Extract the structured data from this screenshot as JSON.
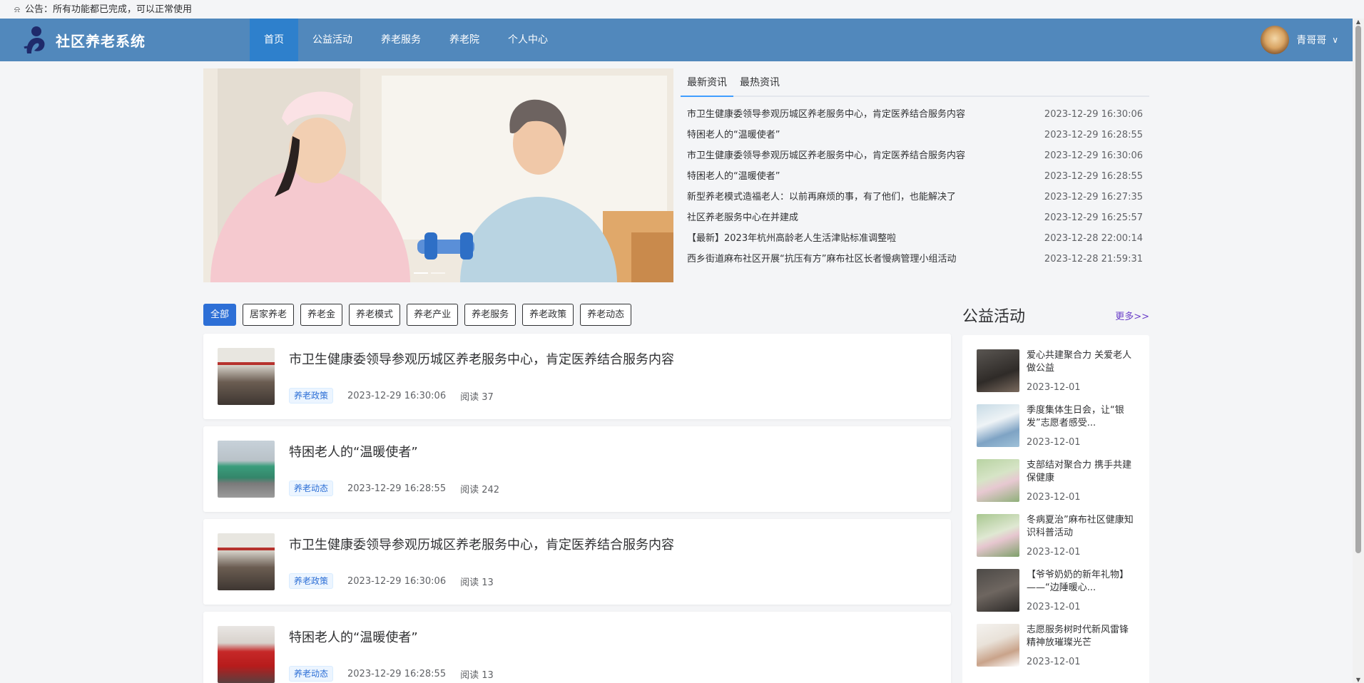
{
  "notice": {
    "text": "公告：所有功能都已完成，可以正常使用"
  },
  "brand": {
    "title": "社区养老系统",
    "nav_color": "#5188bc",
    "active_color": "#2e80cc"
  },
  "nav": {
    "items": [
      {
        "label": "首页",
        "active": true
      },
      {
        "label": "公益活动"
      },
      {
        "label": "养老服务"
      },
      {
        "label": "养老院"
      },
      {
        "label": "个人中心"
      }
    ]
  },
  "user": {
    "name": "青哥哥"
  },
  "news": {
    "tabs": [
      "最新资讯",
      "最热资讯"
    ],
    "items": [
      {
        "title": "市卫生健康委领导参观历城区养老服务中心，肯定医养结合服务内容",
        "date": "2023-12-29 16:30:06"
      },
      {
        "title": "特困老人的“温暖使者”",
        "date": "2023-12-29 16:28:55"
      },
      {
        "title": "市卫生健康委领导参观历城区养老服务中心，肯定医养结合服务内容",
        "date": "2023-12-29 16:30:06"
      },
      {
        "title": "特困老人的“温暖使者”",
        "date": "2023-12-29 16:28:55"
      },
      {
        "title": "新型养老模式造福老人：以前再麻烦的事，有了他们，也能解决了",
        "date": "2023-12-29 16:27:35"
      },
      {
        "title": "社区养老服务中心在并建成",
        "date": "2023-12-29 16:25:57"
      },
      {
        "title": "【最新】2023年杭州高龄老人生活津贴标准调整啦",
        "date": "2023-12-28 22:00:14"
      },
      {
        "title": "西乡街道麻布社区开展“抗压有方”麻布社区长者慢病管理小组活动",
        "date": "2023-12-28 21:59:31"
      }
    ]
  },
  "filters": [
    "全部",
    "居家养老",
    "养老金",
    "养老模式",
    "养老产业",
    "养老服务",
    "养老政策",
    "养老动态"
  ],
  "articles": [
    {
      "title": "市卫生健康委领导参观历城区养老服务中心，肯定医养结合服务内容",
      "tag": "养老政策",
      "time": "2023-12-29 16:30:06",
      "reads": "阅读 37",
      "thumb": "classroom"
    },
    {
      "title": "特困老人的“温暖使者”",
      "tag": "养老动态",
      "time": "2023-12-29 16:28:55",
      "reads": "阅读 242",
      "thumb": "street"
    },
    {
      "title": "市卫生健康委领导参观历城区养老服务中心，肯定医养结合服务内容",
      "tag": "养老政策",
      "time": "2023-12-29 16:30:06",
      "reads": "阅读 13",
      "thumb": "classroom"
    },
    {
      "title": "特困老人的“温暖使者”",
      "tag": "养老动态",
      "time": "2023-12-29 16:28:55",
      "reads": "阅读 13",
      "thumb": "red"
    }
  ],
  "activities": {
    "heading": "公益活动",
    "more": "更多>>",
    "items": [
      {
        "title": "爱心共建聚合力 关爱老人做公益",
        "date": "2023-12-01"
      },
      {
        "title": "季度集体生日会，让“银发”志愿者感受...",
        "date": "2023-12-01"
      },
      {
        "title": "支部结对聚合力 携手共建保健康",
        "date": "2023-12-01"
      },
      {
        "title": "冬病夏治”麻布社区健康知识科普活动",
        "date": "2023-12-01"
      },
      {
        "title": "【爷爷奶奶的新年礼物】——“边陲暖心...",
        "date": "2023-12-01"
      },
      {
        "title": "志愿服务树时代新风雷锋精神放璀璨光芒",
        "date": "2023-12-01"
      }
    ]
  }
}
